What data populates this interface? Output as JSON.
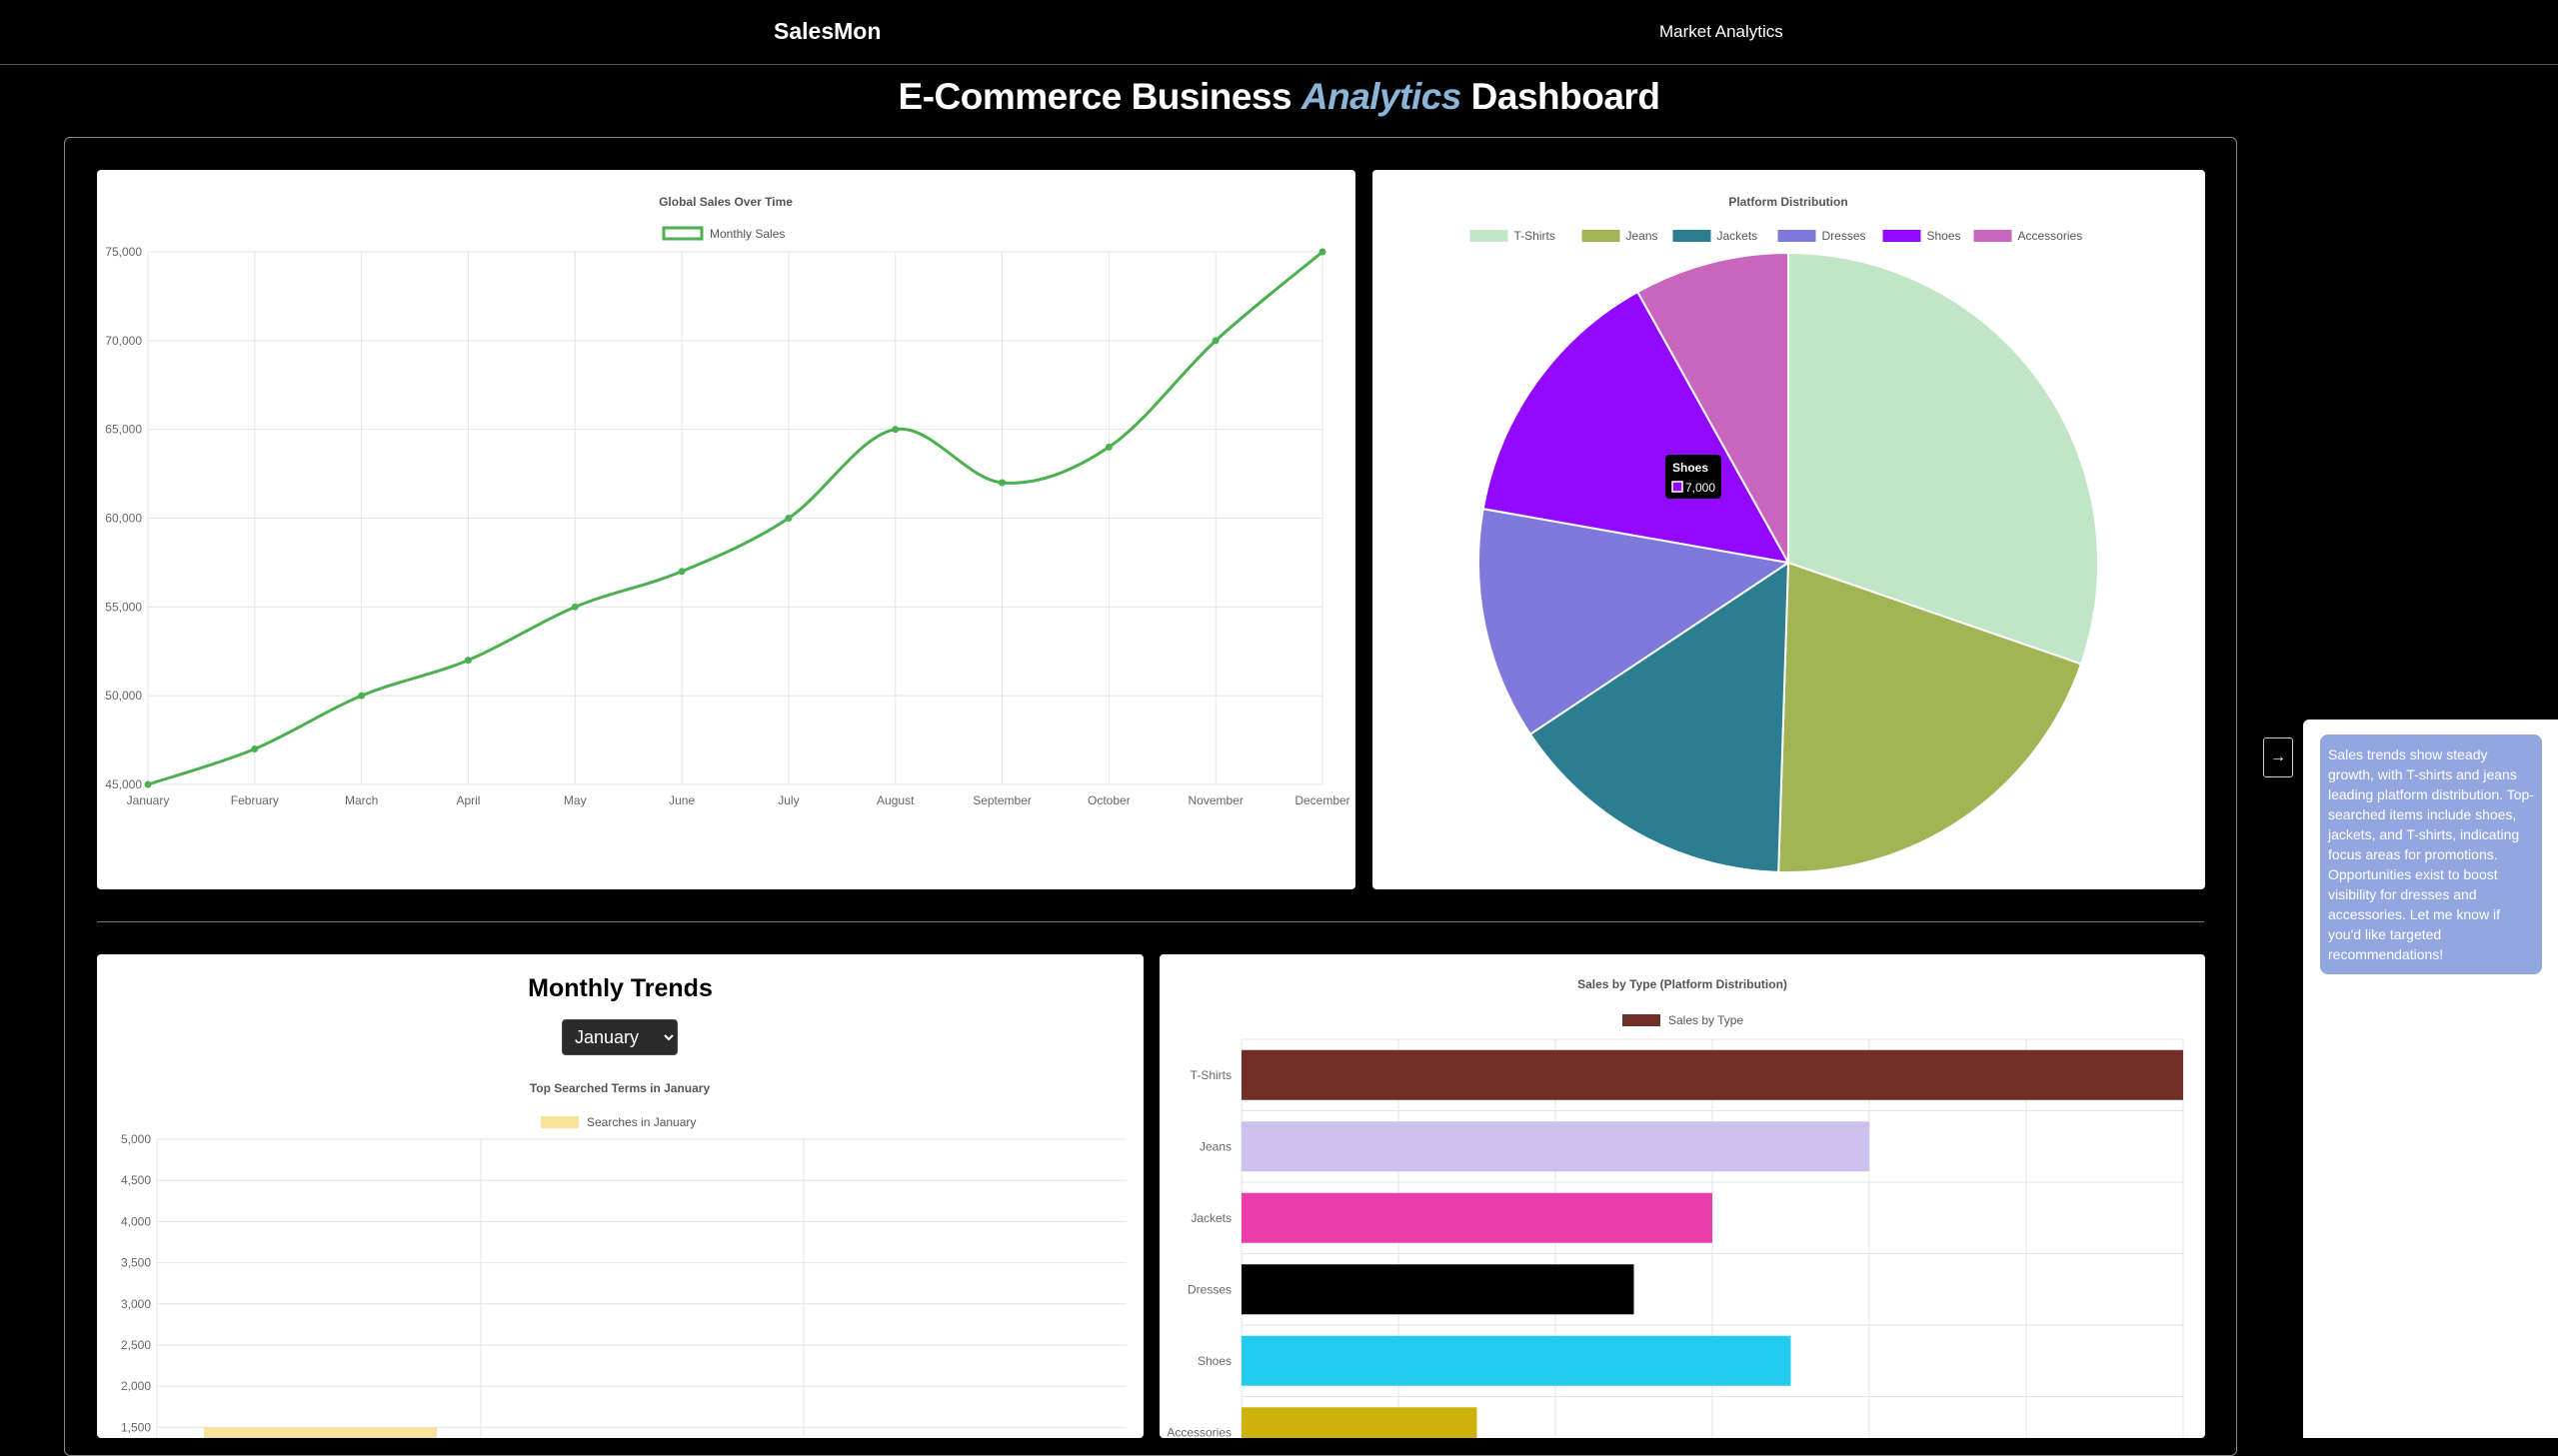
{
  "nav": {
    "brand": "SalesMon",
    "link": "Market Analytics"
  },
  "page": {
    "title_part1": "E-Commerce Business",
    "title_accent": "Analytics",
    "title_part2": "Dashboard"
  },
  "line_chart": {
    "chart_data": {
      "type": "line",
      "title": "Global Sales Over Time",
      "legend": "Monthly Sales",
      "color": "#4caf50",
      "categories": [
        "January",
        "February",
        "March",
        "April",
        "May",
        "June",
        "July",
        "August",
        "September",
        "October",
        "November",
        "December"
      ],
      "values": [
        45000,
        47000,
        50000,
        52000,
        55000,
        57000,
        60000,
        65000,
        62000,
        64000,
        70000,
        75000
      ],
      "ylim": [
        45000,
        75000
      ],
      "yticks": [
        "45,000",
        "50,000",
        "55,000",
        "60,000",
        "65,000",
        "70,000",
        "75,000"
      ],
      "grid": true
    }
  },
  "pie_chart": {
    "chart_data": {
      "type": "pie",
      "title": "Platform Distribution",
      "labels": [
        "T-Shirts",
        "Jeans",
        "Jackets",
        "Dresses",
        "Shoes",
        "Accessories"
      ],
      "values": [
        15000,
        10000,
        7500,
        6000,
        7000,
        4000
      ],
      "colors": [
        "#c1e5c7",
        "#a1b555",
        "#2b7e8f",
        "#8079dc",
        "#9309ff",
        "#c965bd"
      ],
      "legend_position": "top"
    },
    "tooltip": {
      "title": "Shoes",
      "value": "7,000"
    }
  },
  "trends": {
    "title": "Monthly Trends",
    "selected_month": "January",
    "chart_data": {
      "type": "bar",
      "title": "Top Searched Terms in January",
      "legend": "Searches in January",
      "color": "#f8e39a",
      "values": [
        1500
      ],
      "ylim": [
        1500,
        5000
      ],
      "yticks": [
        "1,500",
        "2,000",
        "2,500",
        "3,000",
        "3,500",
        "4,000",
        "4,500",
        "5,000"
      ]
    }
  },
  "type_chart": {
    "chart_data": {
      "type": "bar",
      "orientation": "horizontal",
      "title": "Sales by Type (Platform Distribution)",
      "legend": "Sales by Type",
      "legend_color": "#722f27",
      "categories": [
        "T-Shirts",
        "Jeans",
        "Jackets",
        "Dresses",
        "Shoes",
        "Accessories"
      ],
      "values": [
        15000,
        10000,
        7500,
        6250,
        8750,
        3750
      ],
      "colors": [
        "#722f27",
        "#cdbfee",
        "#ea3dac",
        "#000000",
        "#23cbee",
        "#cdb20e"
      ],
      "xlim": [
        0,
        15000
      ],
      "grid": true
    }
  },
  "assistant": {
    "toggle": "→",
    "message": "Sales trends show steady growth, with T-shirts and jeans leading platform distribution. Top-searched items include shoes, jackets, and T-shirts, indicating focus areas for promotions. Opportunities exist to boost visibility for dresses and accessories. Let me know if you'd like targeted recommendations!"
  }
}
